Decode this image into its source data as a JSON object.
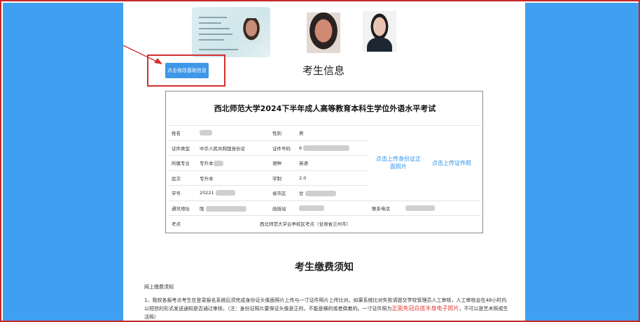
{
  "header": {
    "modify_button": "点击修改基础信息",
    "section_title": "考生信息"
  },
  "exam": {
    "title": "西北师范大学2024下半年成人高等教育本科生学位外语水平考试"
  },
  "fields": {
    "name_label": "姓名",
    "gender_label": "性别",
    "gender_value": "男",
    "id_type_label": "证件类型",
    "id_type_value": "中华人民共和国身份证",
    "id_number_label": "证件号码",
    "id_number_value": "6",
    "major_label": "所属专业",
    "major_value": "专升本",
    "language_label": "语种",
    "language_value": "英语",
    "level_label": "层次",
    "level_value": "专升本",
    "duration_label": "学制",
    "duration_value": "2.0",
    "student_id_label": "学号",
    "student_id_value": "20221",
    "region_label": "省市区",
    "region_value": "甘",
    "address_label": "通讯地址",
    "address_value": "陇",
    "station_label": "函授站",
    "phone_label": "联系电话",
    "venue_label": "考点",
    "venue_value": "西北师范大学云亭校区考点（甘肃省兰州市）"
  },
  "uploads": {
    "id_photo": "点击上传身份证正面照片",
    "cert_photo": "点击上传证件照"
  },
  "notice": {
    "title": "考生缴费须知",
    "heading": "网上缴费须知",
    "body_part1": "1、我校各报考点考生在登录报名系统后须完成身份证头像面照片上传与一寸证件照片上传比对。如果系统比对失败请提交学校管理员人工审核，人工审核会在48小时内以短信的形式发送通知是否通过审核。（注：身份证照片要保证头像是正的，不能是横的或者倒着的。一寸证件照为",
    "body_red": "正面免冠白底半身电子照片",
    "body_part2": "，不可以是艺术照或生活照）"
  }
}
